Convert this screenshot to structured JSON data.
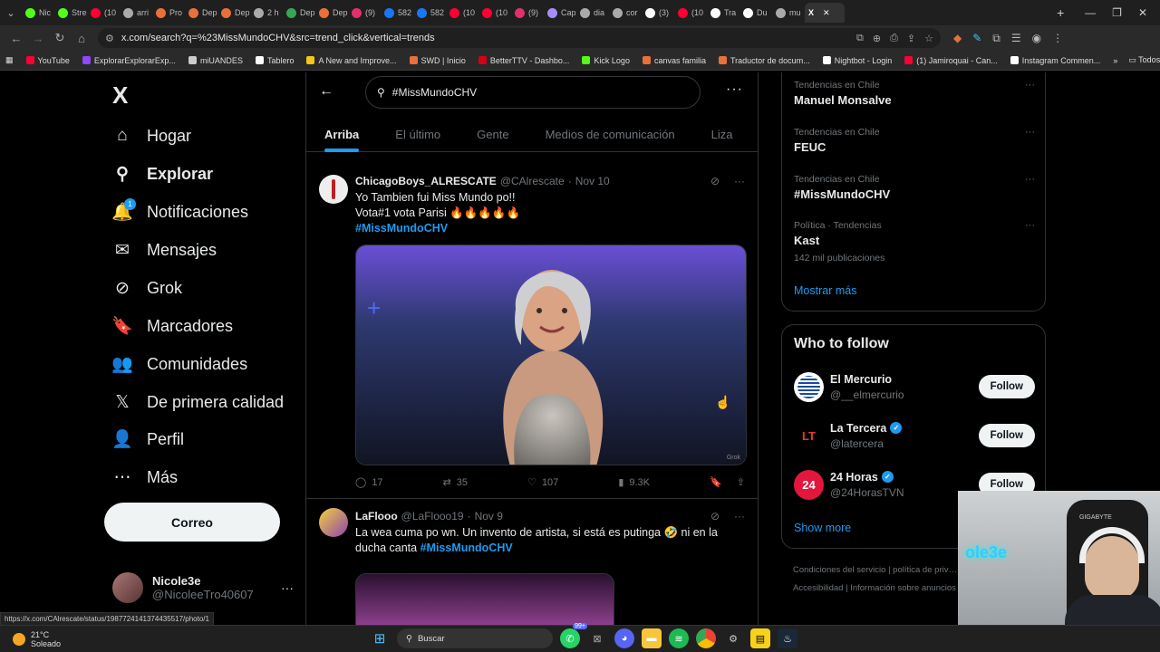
{
  "browser": {
    "tabs": [
      {
        "label": "Nic",
        "color": "#53fc18"
      },
      {
        "label": "Stre",
        "color": "#53fc18"
      },
      {
        "label": "(10",
        "color": "#ff0033"
      },
      {
        "label": "arri",
        "color": "#aaaaaa"
      },
      {
        "label": "Pro",
        "color": "#e8703a"
      },
      {
        "label": "Dep",
        "color": "#e8703a"
      },
      {
        "label": "Dep",
        "color": "#e8703a"
      },
      {
        "label": "2 h",
        "color": "#aaaaaa"
      },
      {
        "label": "Dep",
        "color": "#34a853"
      },
      {
        "label": "Dep",
        "color": "#e8703a"
      },
      {
        "label": "(9)",
        "color": "#e1306c"
      },
      {
        "label": "582",
        "color": "#1877f2"
      },
      {
        "label": "582",
        "color": "#1877f2"
      },
      {
        "label": "(10",
        "color": "#ff0033"
      },
      {
        "label": "(10",
        "color": "#ff0033"
      },
      {
        "label": "(9)",
        "color": "#e1306c"
      },
      {
        "label": "Cap",
        "color": "#a78bfa"
      },
      {
        "label": "dia",
        "color": "#aaaaaa"
      },
      {
        "label": "cor",
        "color": "#aaaaaa"
      },
      {
        "label": "(3)",
        "color": "#ffffff"
      },
      {
        "label": "(10",
        "color": "#ff0033"
      },
      {
        "label": "Tra",
        "color": "#ffffff"
      },
      {
        "label": "Du",
        "color": "#ffffff"
      },
      {
        "label": "mu",
        "color": "#aaaaaa"
      }
    ],
    "active_tab_icon": "X",
    "new_tab": "+",
    "url": "x.com/search?q=%23MissMundoCHV&src=trend_click&vertical=trends",
    "bookmarks": [
      {
        "label": "YouTube",
        "color": "#ff0033"
      },
      {
        "label": "ExplorarExplorarExp...",
        "color": "#9146ff"
      },
      {
        "label": "miUANDES",
        "color": "#cccccc"
      },
      {
        "label": "Tablero",
        "color": "#ffffff"
      },
      {
        "label": "A New and Improve...",
        "color": "#f5c518"
      },
      {
        "label": "SWD | Inicio",
        "color": "#e8703a"
      },
      {
        "label": "BetterTTV - Dashbo...",
        "color": "#d50014"
      },
      {
        "label": "Kick Logo",
        "color": "#53fc18"
      },
      {
        "label": "canvas familia",
        "color": "#e8703a"
      },
      {
        "label": "Traductor de docum...",
        "color": "#e8703a"
      },
      {
        "label": "Nightbot - Login",
        "color": "#ffffff"
      },
      {
        "label": "(1) Jamiroquai - Can...",
        "color": "#ff0033"
      },
      {
        "label": "Instagram Commen...",
        "color": "#ffffff"
      }
    ],
    "all_bookmarks": "Todos los marcadores",
    "status_url": "https://x.com/CAlrescate/status/1987724141374435517/photo/1"
  },
  "sidebar": {
    "logo": "X",
    "items": [
      {
        "label": "Hogar",
        "icon": "⌂",
        "name": "home"
      },
      {
        "label": "Explorar",
        "icon": "⚲",
        "name": "explore"
      },
      {
        "label": "Notificaciones",
        "icon": "🔔",
        "name": "notifications",
        "badge": "1"
      },
      {
        "label": "Mensajes",
        "icon": "✉",
        "name": "messages"
      },
      {
        "label": "Grok",
        "icon": "⊘",
        "name": "grok"
      },
      {
        "label": "Marcadores",
        "icon": "🔖",
        "name": "bookmarks"
      },
      {
        "label": "Comunidades",
        "icon": "👥",
        "name": "communities"
      },
      {
        "label": "De primera calidad",
        "icon": "𝕏",
        "name": "premium"
      },
      {
        "label": "Perfil",
        "icon": "👤",
        "name": "profile"
      },
      {
        "label": "Más",
        "icon": "⋯",
        "name": "more"
      }
    ],
    "post_button": "Correo",
    "user": {
      "name": "Nicole3e",
      "handle": "@NicoleeTro40607",
      "more": "···"
    }
  },
  "main": {
    "search_value": "#MissMundoCHV",
    "tabs": [
      "Arriba",
      "El último",
      "Gente",
      "Medios de comunicación",
      "Liza"
    ],
    "tweets": [
      {
        "name": "ChicagoBoys_ALRESCATE",
        "handle": "@CAlrescate",
        "date": "Nov 10",
        "line1": "Yo Tambien fui Miss Mundo po!!",
        "line2": "Vota#1 vota Parisi 🔥🔥🔥🔥🔥",
        "hashtag": "#MissMundoCHV",
        "media_watermark": "Grok",
        "replies": "17",
        "reposts": "35",
        "likes": "107",
        "views": "9.3K"
      },
      {
        "name": "LaFlooo",
        "handle": "@LaFlooo19",
        "date": "Nov 9",
        "line1": "La wea cuma po wn. Un invento de artista, si está es putinga 🤣 ni en la",
        "line2": "ducha canta",
        "hashtag": "#MissMundoCHV"
      }
    ]
  },
  "right": {
    "trends": [
      {
        "category": "Tendencias en Chile",
        "title": "Manuel Monsalve",
        "count": ""
      },
      {
        "category": "Tendencias en Chile",
        "title": "FEUC",
        "count": ""
      },
      {
        "category": "Tendencias en Chile",
        "title": "#MissMundoCHV",
        "count": ""
      },
      {
        "category": "Política · Tendencias",
        "title": "Kast",
        "count": "142 mil publicaciones"
      }
    ],
    "trends_show_more": "Mostrar más",
    "who_to_follow": "Who to follow",
    "follow": [
      {
        "name": "El Mercurio",
        "handle": "@__elmercurio",
        "verified": false,
        "avatar_text": "",
        "avatar_bg": "#ffffff",
        "avatar_fg": "#1a4a9c"
      },
      {
        "name": "La Tercera",
        "handle": "@latercera",
        "verified": true,
        "avatar_text": "LT",
        "avatar_bg": "#000000",
        "avatar_fg": "#e53935"
      },
      {
        "name": "24 Horas",
        "handle": "@24HorasTVN",
        "verified": true,
        "avatar_text": "24",
        "avatar_bg": "#e3173e",
        "avatar_fg": "#ffffff"
      }
    ],
    "follow_label": "Follow",
    "wtf_show_more": "Show more",
    "footer": "Condiciones del servicio  |  política de priv…  Política de cookies  |  Accesibilidad  |  Información sobre anuncios  |  Más ···"
  },
  "webcam": {
    "overlay": "ole3e",
    "brand": "GIGABYTE"
  },
  "taskbar": {
    "temp": "21°C",
    "weather": "Soleado",
    "search_placeholder": "Buscar",
    "notif_badge": "99+"
  }
}
